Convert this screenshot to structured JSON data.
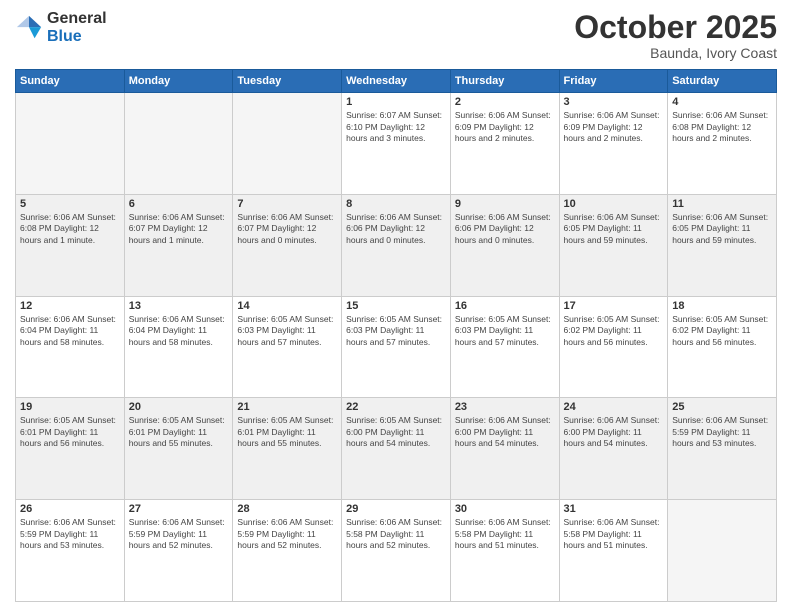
{
  "logo": {
    "general": "General",
    "blue": "Blue"
  },
  "header": {
    "month": "October 2025",
    "location": "Baunda, Ivory Coast"
  },
  "weekdays": [
    "Sunday",
    "Monday",
    "Tuesday",
    "Wednesday",
    "Thursday",
    "Friday",
    "Saturday"
  ],
  "weeks": [
    [
      {
        "day": "",
        "info": "",
        "empty": true
      },
      {
        "day": "",
        "info": "",
        "empty": true
      },
      {
        "day": "",
        "info": "",
        "empty": true
      },
      {
        "day": "1",
        "info": "Sunrise: 6:07 AM\nSunset: 6:10 PM\nDaylight: 12 hours\nand 3 minutes."
      },
      {
        "day": "2",
        "info": "Sunrise: 6:06 AM\nSunset: 6:09 PM\nDaylight: 12 hours\nand 2 minutes."
      },
      {
        "day": "3",
        "info": "Sunrise: 6:06 AM\nSunset: 6:09 PM\nDaylight: 12 hours\nand 2 minutes."
      },
      {
        "day": "4",
        "info": "Sunrise: 6:06 AM\nSunset: 6:08 PM\nDaylight: 12 hours\nand 2 minutes."
      }
    ],
    [
      {
        "day": "5",
        "info": "Sunrise: 6:06 AM\nSunset: 6:08 PM\nDaylight: 12 hours\nand 1 minute.",
        "shaded": true
      },
      {
        "day": "6",
        "info": "Sunrise: 6:06 AM\nSunset: 6:07 PM\nDaylight: 12 hours\nand 1 minute.",
        "shaded": true
      },
      {
        "day": "7",
        "info": "Sunrise: 6:06 AM\nSunset: 6:07 PM\nDaylight: 12 hours\nand 0 minutes.",
        "shaded": true
      },
      {
        "day": "8",
        "info": "Sunrise: 6:06 AM\nSunset: 6:06 PM\nDaylight: 12 hours\nand 0 minutes.",
        "shaded": true
      },
      {
        "day": "9",
        "info": "Sunrise: 6:06 AM\nSunset: 6:06 PM\nDaylight: 12 hours\nand 0 minutes.",
        "shaded": true
      },
      {
        "day": "10",
        "info": "Sunrise: 6:06 AM\nSunset: 6:05 PM\nDaylight: 11 hours\nand 59 minutes.",
        "shaded": true
      },
      {
        "day": "11",
        "info": "Sunrise: 6:06 AM\nSunset: 6:05 PM\nDaylight: 11 hours\nand 59 minutes.",
        "shaded": true
      }
    ],
    [
      {
        "day": "12",
        "info": "Sunrise: 6:06 AM\nSunset: 6:04 PM\nDaylight: 11 hours\nand 58 minutes."
      },
      {
        "day": "13",
        "info": "Sunrise: 6:06 AM\nSunset: 6:04 PM\nDaylight: 11 hours\nand 58 minutes."
      },
      {
        "day": "14",
        "info": "Sunrise: 6:05 AM\nSunset: 6:03 PM\nDaylight: 11 hours\nand 57 minutes."
      },
      {
        "day": "15",
        "info": "Sunrise: 6:05 AM\nSunset: 6:03 PM\nDaylight: 11 hours\nand 57 minutes."
      },
      {
        "day": "16",
        "info": "Sunrise: 6:05 AM\nSunset: 6:03 PM\nDaylight: 11 hours\nand 57 minutes."
      },
      {
        "day": "17",
        "info": "Sunrise: 6:05 AM\nSunset: 6:02 PM\nDaylight: 11 hours\nand 56 minutes."
      },
      {
        "day": "18",
        "info": "Sunrise: 6:05 AM\nSunset: 6:02 PM\nDaylight: 11 hours\nand 56 minutes."
      }
    ],
    [
      {
        "day": "19",
        "info": "Sunrise: 6:05 AM\nSunset: 6:01 PM\nDaylight: 11 hours\nand 56 minutes.",
        "shaded": true
      },
      {
        "day": "20",
        "info": "Sunrise: 6:05 AM\nSunset: 6:01 PM\nDaylight: 11 hours\nand 55 minutes.",
        "shaded": true
      },
      {
        "day": "21",
        "info": "Sunrise: 6:05 AM\nSunset: 6:01 PM\nDaylight: 11 hours\nand 55 minutes.",
        "shaded": true
      },
      {
        "day": "22",
        "info": "Sunrise: 6:05 AM\nSunset: 6:00 PM\nDaylight: 11 hours\nand 54 minutes.",
        "shaded": true
      },
      {
        "day": "23",
        "info": "Sunrise: 6:06 AM\nSunset: 6:00 PM\nDaylight: 11 hours\nand 54 minutes.",
        "shaded": true
      },
      {
        "day": "24",
        "info": "Sunrise: 6:06 AM\nSunset: 6:00 PM\nDaylight: 11 hours\nand 54 minutes.",
        "shaded": true
      },
      {
        "day": "25",
        "info": "Sunrise: 6:06 AM\nSunset: 5:59 PM\nDaylight: 11 hours\nand 53 minutes.",
        "shaded": true
      }
    ],
    [
      {
        "day": "26",
        "info": "Sunrise: 6:06 AM\nSunset: 5:59 PM\nDaylight: 11 hours\nand 53 minutes."
      },
      {
        "day": "27",
        "info": "Sunrise: 6:06 AM\nSunset: 5:59 PM\nDaylight: 11 hours\nand 52 minutes."
      },
      {
        "day": "28",
        "info": "Sunrise: 6:06 AM\nSunset: 5:59 PM\nDaylight: 11 hours\nand 52 minutes."
      },
      {
        "day": "29",
        "info": "Sunrise: 6:06 AM\nSunset: 5:58 PM\nDaylight: 11 hours\nand 52 minutes."
      },
      {
        "day": "30",
        "info": "Sunrise: 6:06 AM\nSunset: 5:58 PM\nDaylight: 11 hours\nand 51 minutes."
      },
      {
        "day": "31",
        "info": "Sunrise: 6:06 AM\nSunset: 5:58 PM\nDaylight: 11 hours\nand 51 minutes."
      },
      {
        "day": "",
        "info": "",
        "empty": true
      }
    ]
  ]
}
